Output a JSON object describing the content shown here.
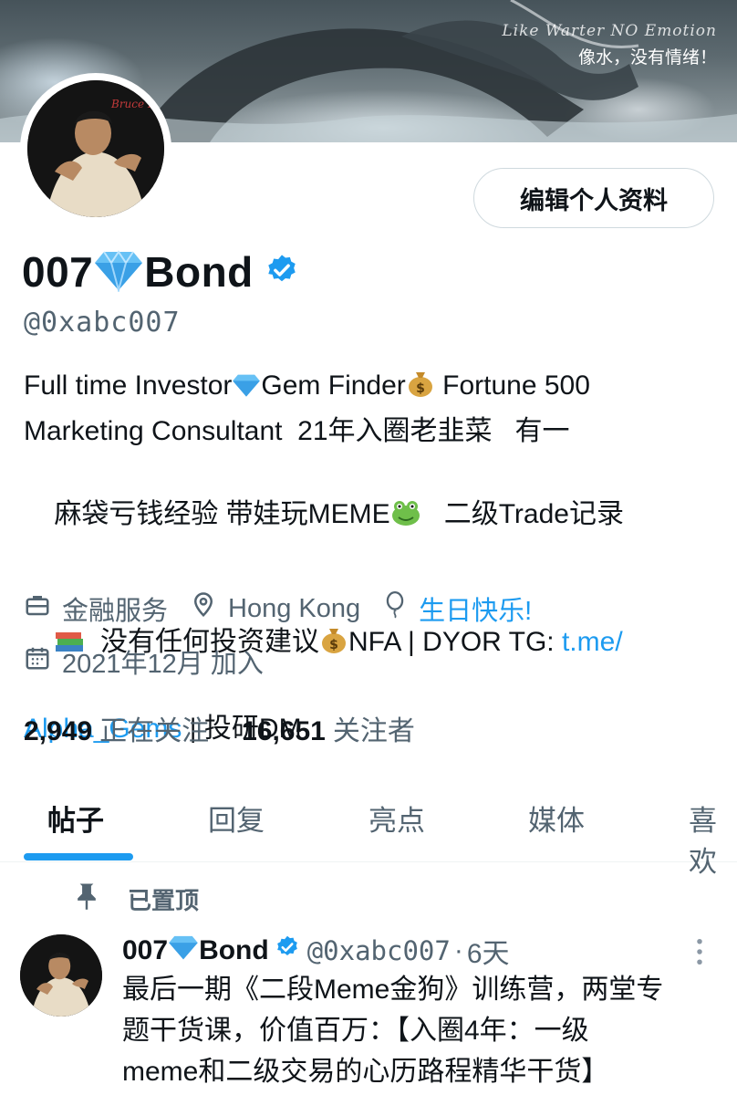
{
  "banner": {
    "tagline_script": "Like Warter NO Emotion",
    "tagline_cn": "像水，没有情绪！"
  },
  "profile": {
    "edit_button": "编辑个人资料",
    "name_prefix": "007",
    "name_suffix": "Bond",
    "handle": "@0xabc007",
    "bio": {
      "line1_a": "Full time Investor",
      "line1_b": "Gem Finder",
      "line1_c": " Fortune 500",
      "line2": "Marketing Consultant  21年入圈老韭菜   有一",
      "line3_a": "麻袋亏钱经验 带娃玩MEME",
      "line3_b": "   二级Trade记录",
      "line4_a": "  没有任何投资建议",
      "line4_b": "NFA | DYOR TG: ",
      "link_part1": "t.me/",
      "link_part2": "Alpha_Gems",
      "line5_b": " | 投研DM"
    },
    "meta": {
      "category": "金融服务",
      "location": "Hong Kong",
      "birthday": "生日快乐!",
      "joined": "2021年12月 加入"
    },
    "stats": {
      "following_count": "2,949",
      "following_label": "正在关注",
      "followers_count": "16,651",
      "followers_label": "关注者"
    }
  },
  "tabs": [
    "帖子",
    "回复",
    "亮点",
    "媒体",
    "喜欢"
  ],
  "pinned_label": "已置顶",
  "tweet": {
    "name_prefix": "007",
    "name_suffix": "Bond",
    "handle": "@0xabc007",
    "dot": "·",
    "time": "6天",
    "line1": "最后一期《二段Meme金狗》训练营，两堂专",
    "line2": "题干货课，价值百万：【入圈4年：一级",
    "line3": "meme和二级交易的心历路程精华干货】"
  },
  "colors": {
    "accent": "#1d9bf0",
    "text_primary": "#0f1419",
    "text_secondary": "#536471"
  }
}
